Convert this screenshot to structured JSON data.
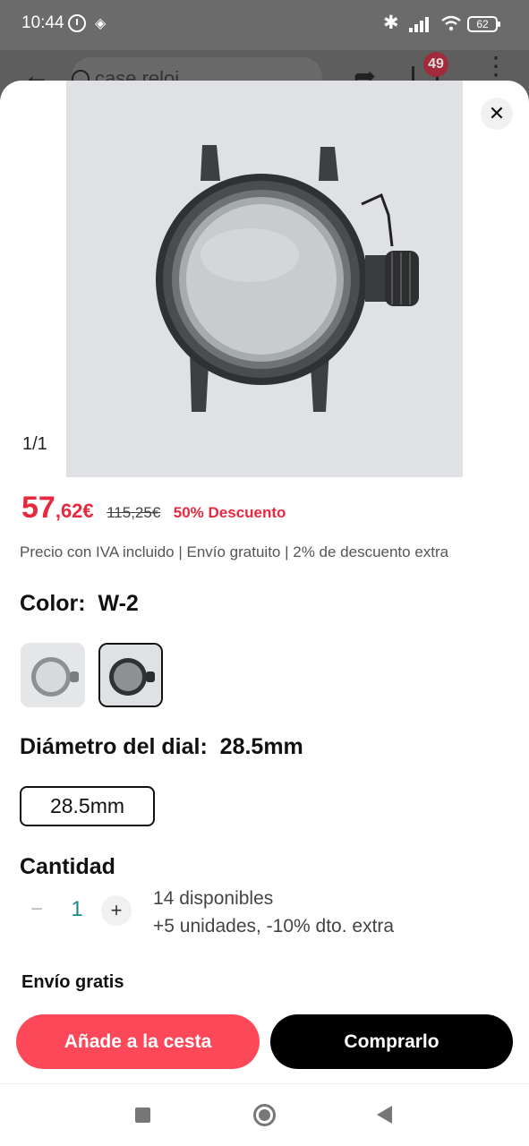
{
  "status_bar": {
    "time": "10:44",
    "battery": "62"
  },
  "header": {
    "search_text": "case reloj",
    "cart_badge": "49"
  },
  "sheet": {
    "image_counter": "1/1",
    "price": {
      "integer": "57",
      "decimal": ",62€",
      "original": "115,25€",
      "discount": "50% Descuento"
    },
    "tax_info": "Precio con IVA incluido | Envío gratuito | 2% de descuento extra",
    "color": {
      "label": "Color:",
      "selected": "W-2",
      "swatches": [
        "silver-watch-case",
        "black-watch-case"
      ]
    },
    "dial": {
      "label": "Diámetro del dial:",
      "selected": "28.5mm",
      "options": [
        "28.5mm"
      ]
    },
    "quantity": {
      "label": "Cantidad",
      "value": "1",
      "minus": "−",
      "plus": "+",
      "stock": "14 disponibles",
      "extra": "+5 unidades, -10% dto. extra"
    },
    "shipping": "Envío gratis",
    "buttons": {
      "add_to_cart": "Añade a la cesta",
      "buy_now": "Comprarlo"
    },
    "close": "✕"
  },
  "colors": {
    "price_red": "#e8283f",
    "add_to_cart_bg": "#fc4859",
    "buy_bg": "#000000",
    "stepper_value": "#1a8a8a"
  }
}
